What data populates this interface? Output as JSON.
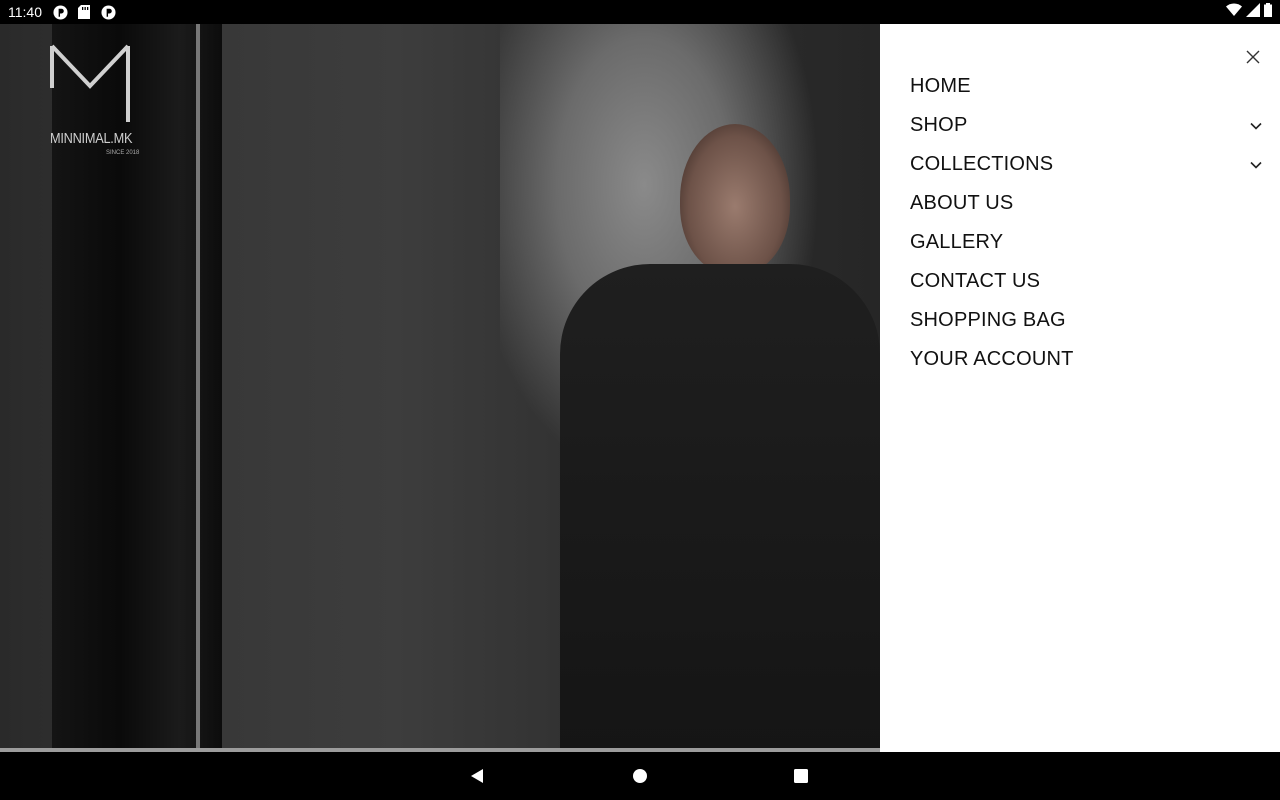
{
  "status_bar": {
    "time": "11:40",
    "left_icons": [
      "pinterest-icon",
      "sd-card-icon",
      "pinterest-icon"
    ],
    "right_icons": [
      "wifi-icon",
      "signal-icon",
      "battery-icon"
    ]
  },
  "hero": {
    "logo_text": "MINNIMAL.MK",
    "logo_sub": "SINCE 2018"
  },
  "menu": {
    "close_icon": "close-icon",
    "items": [
      {
        "label": "HOME",
        "has_submenu": false
      },
      {
        "label": "SHOP",
        "has_submenu": true
      },
      {
        "label": "COLLECTIONS",
        "has_submenu": true
      },
      {
        "label": "ABOUT US",
        "has_submenu": false
      },
      {
        "label": "GALLERY",
        "has_submenu": false
      },
      {
        "label": "CONTACT US",
        "has_submenu": false
      },
      {
        "label": "SHOPPING BAG",
        "has_submenu": false
      },
      {
        "label": "YOUR ACCOUNT",
        "has_submenu": false
      }
    ]
  },
  "nav_bar": {
    "buttons": [
      "back-icon",
      "home-icon",
      "recents-icon"
    ]
  },
  "colors": {
    "menu_background": "#ffffff",
    "menu_text": "#111111",
    "system_bars": "#000000"
  }
}
